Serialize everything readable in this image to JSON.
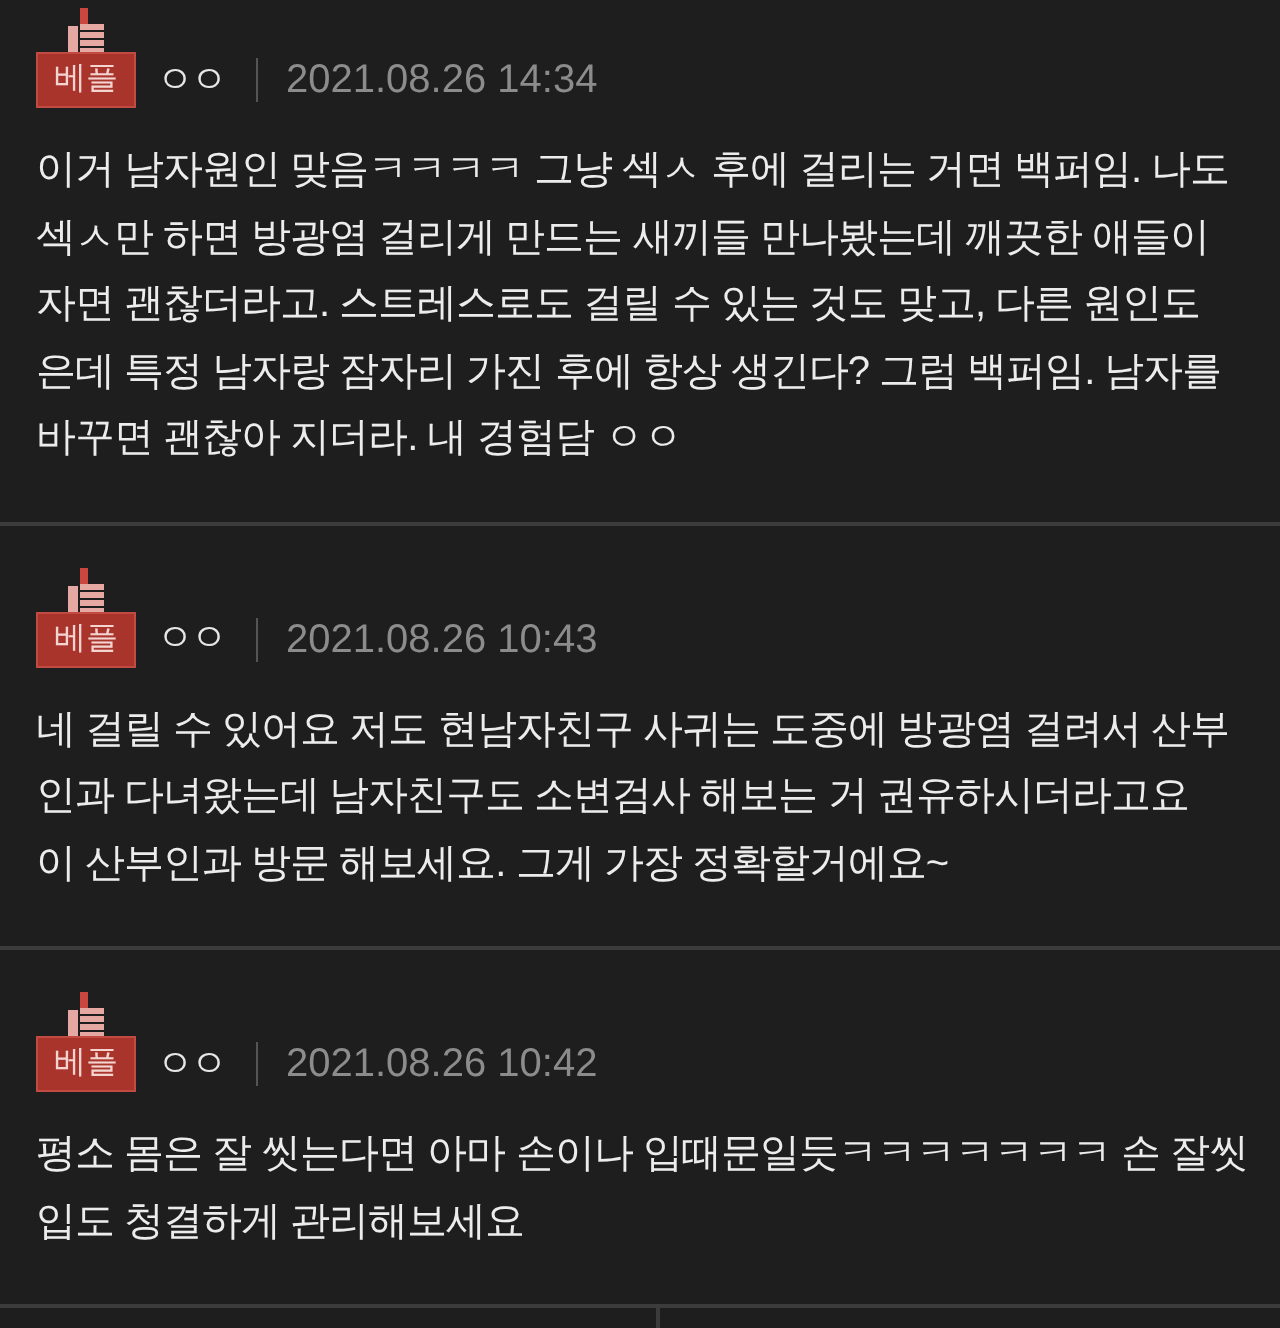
{
  "comments": [
    {
      "badge": "베플",
      "author": "ㅇㅇ",
      "date": "2021.08.26 14:34",
      "lines": [
        "이거 남자원인 맞음ㅋㅋㅋㅋ 그냥 섹ㅅ 후에 걸리는 거면 백퍼임. 나도",
        "섹ㅅ만 하면 방광염 걸리게 만드는 새끼들 만나봤는데 깨끗한 애들이",
        "자면 괜찮더라고. 스트레스로도 걸릴 수 있는 것도 맞고, 다른 원인도",
        "은데 특정 남자랑 잠자리 가진 후에 항상 생긴다? 그럼 백퍼임. 남자를",
        "바꾸면 괜찮아 지더라. 내 경험담 ㅇㅇ"
      ]
    },
    {
      "badge": "베플",
      "author": "ㅇㅇ",
      "date": "2021.08.26 10:43",
      "lines": [
        "네 걸릴 수 있어요 저도 현남자친구 사귀는 도중에 방광염 걸려서 산부",
        "인과 다녀왔는데 남자친구도 소변검사 해보는 거 권유하시더라고요",
        "이 산부인과 방문 해보세요. 그게 가장 정확할거에요~"
      ]
    },
    {
      "badge": "베플",
      "author": "ㅇㅇ",
      "date": "2021.08.26 10:42",
      "lines": [
        "평소 몸은 잘 씻는다면 아마 손이나 입때문일듯ㅋㅋㅋㅋㅋㅋㅋ 손 잘씻",
        "입도 청결하게 관리해보세요"
      ]
    }
  ]
}
